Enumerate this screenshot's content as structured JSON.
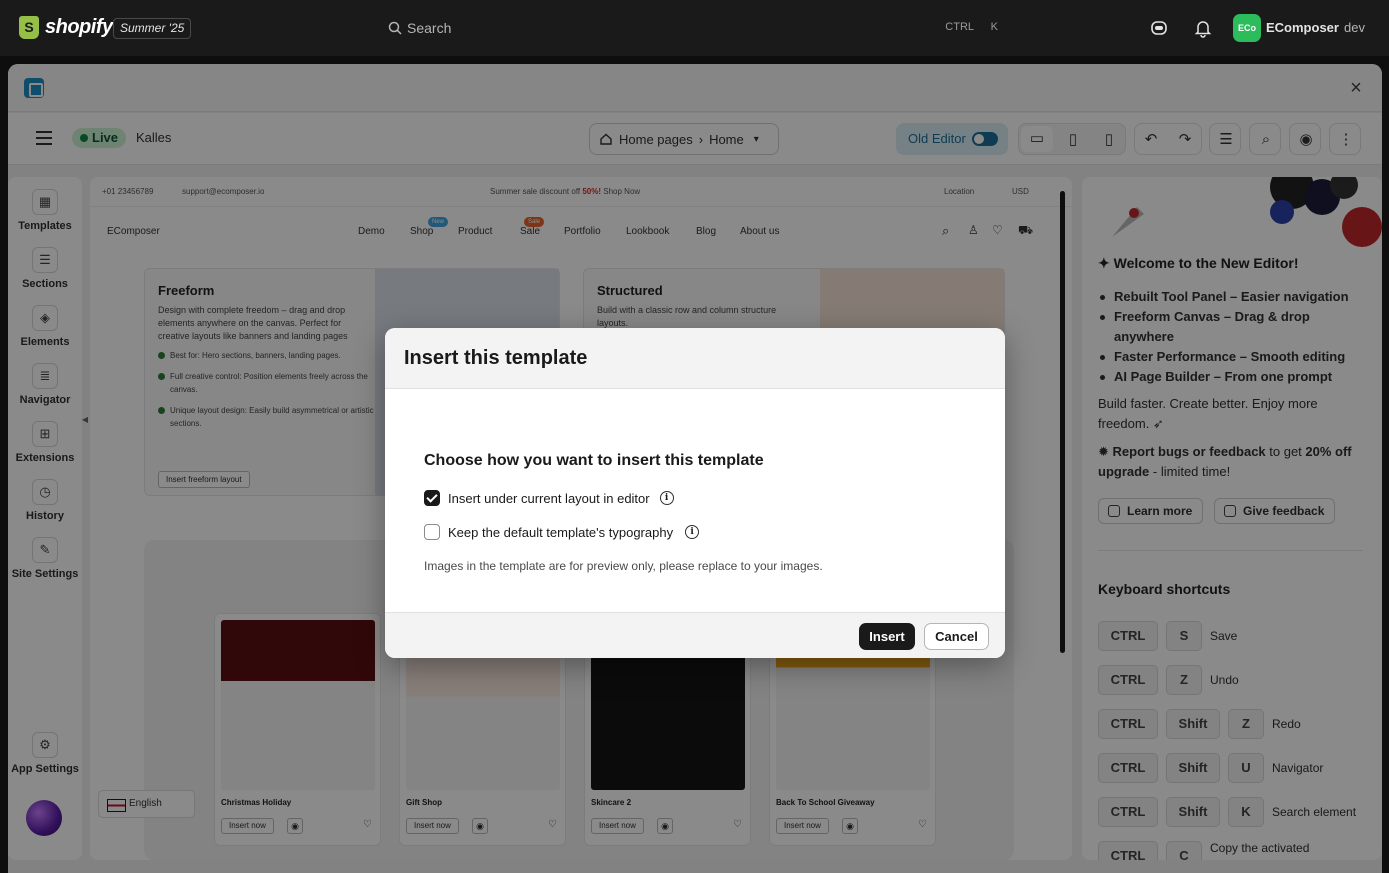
{
  "topbar": {
    "brand": "shopify",
    "logo_letter": "S",
    "edition": "Summer '25",
    "search_placeholder": "Search",
    "shortcut": "CTRL K",
    "store_avatar": "ECo",
    "store_name": "EComposer",
    "store_handle": "dev",
    "icons": [
      "search-icon",
      "sidekick-icon",
      "bell-icon"
    ]
  },
  "app": {
    "close_glyph": "×"
  },
  "toolbar": {
    "status": "Live",
    "theme": "Kalles",
    "breadcrumb_parent": "Home pages",
    "breadcrumb_sep": "›",
    "breadcrumb_current": "Home",
    "old_editor_label": "Old Editor"
  },
  "sidebar": {
    "items": [
      {
        "label": "Templates",
        "icon": "templates-icon"
      },
      {
        "label": "Sections",
        "icon": "sections-icon"
      },
      {
        "label": "Elements",
        "icon": "elements-icon"
      },
      {
        "label": "Navigator",
        "icon": "navigator-icon"
      },
      {
        "label": "Extensions",
        "icon": "extensions-icon"
      },
      {
        "label": "History",
        "icon": "history-icon"
      },
      {
        "label": "Site Settings",
        "icon": "site-settings-icon"
      }
    ],
    "app_settings": "App Settings"
  },
  "canvas": {
    "phone": "+01 23456789",
    "email": "support@ecomposer.io",
    "announcement_prefix": "Summer sale discount off ",
    "announcement_highlight": "50%!",
    "announcement_suffix": " Shop Now",
    "location": "Location",
    "currency": "USD",
    "site_logo": "EComposer",
    "nav_links": [
      "Demo",
      "Shop",
      "Product",
      "Sale",
      "Portfolio",
      "Lookbook",
      "Blog",
      "About us"
    ],
    "badge_new": "New",
    "badge_sale": "Sale",
    "freeform": {
      "title": "Freeform",
      "desc": "Design with complete freedom – drag and drop elements anywhere on the canvas. Perfect for creative layouts like banners and landing pages",
      "bullets": [
        "Best for: Hero sections, banners, landing pages.",
        "Full creative control: Position elements freely across the canvas.",
        "Unique layout design: Easily build asymmetrical or artistic sections."
      ],
      "button": "Insert freeform layout"
    },
    "structured": {
      "title": "Structured",
      "desc": "Build with a classic row and column structure layouts."
    },
    "templates": [
      {
        "name": "Christmas Holiday",
        "insert": "Insert now"
      },
      {
        "name": "Gift Shop",
        "insert": "Insert now"
      },
      {
        "name": "Skincare 2",
        "insert": "Insert now"
      },
      {
        "name": "Back To School Giveaway",
        "insert": "Insert now"
      }
    ],
    "language": "English"
  },
  "right_panel": {
    "welcome": "Welcome to the New Editor!",
    "features": [
      "Rebuilt Tool Panel – Easier navigation",
      "Freeform Canvas – Drag & drop anywhere",
      "Faster Performance – Smooth editing",
      "AI Page Builder – From one prompt"
    ],
    "tagline": "Build faster. Create better. Enjoy more freedom.",
    "promo_bold": "Report bugs or feedback",
    "promo_mid": " to get ",
    "promo_pct": "20% off upgrade",
    "promo_tail": " - limited time!",
    "learn_more": "Learn more",
    "give_feedback": "Give feedback",
    "shortcuts_title": "Keyboard shortcuts",
    "shortcuts": [
      {
        "keys": [
          "CTRL",
          "S"
        ],
        "action": "Save"
      },
      {
        "keys": [
          "CTRL",
          "Z"
        ],
        "action": "Undo"
      },
      {
        "keys": [
          "CTRL",
          "Shift",
          "Z"
        ],
        "action": "Redo"
      },
      {
        "keys": [
          "CTRL",
          "Shift",
          "U"
        ],
        "action": "Navigator"
      },
      {
        "keys": [
          "CTRL",
          "Shift",
          "K"
        ],
        "action": "Search element"
      },
      {
        "keys": [
          "CTRL",
          "C"
        ],
        "action": "Copy the activated"
      }
    ]
  },
  "modal": {
    "title": "Insert this template",
    "heading": "Choose how you want to insert this template",
    "option1": "Insert under current layout in editor",
    "option1_checked": true,
    "option2": "Keep the default template's typography",
    "option2_checked": false,
    "info_glyph": "i",
    "note": "Images in the template are for preview only, please replace to your images.",
    "insert": "Insert",
    "cancel": "Cancel"
  }
}
